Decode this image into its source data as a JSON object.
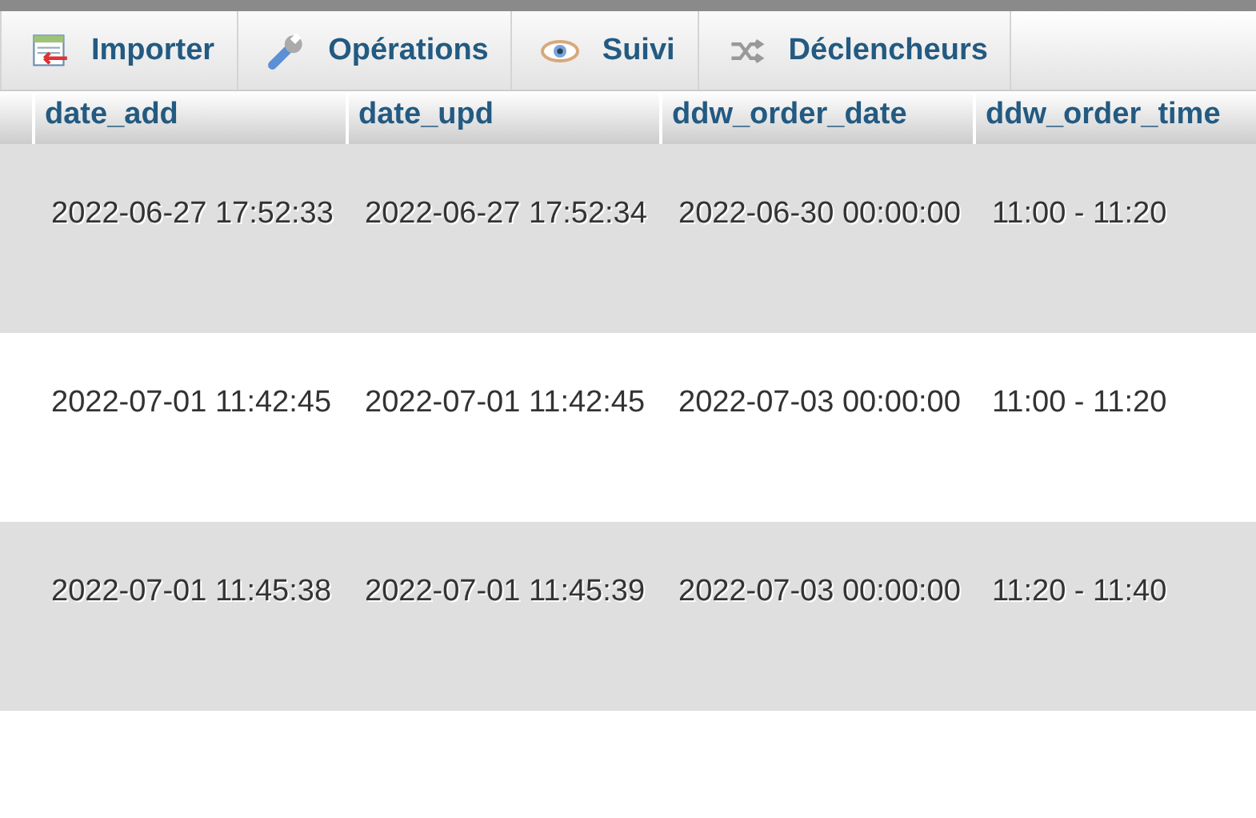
{
  "tabs": [
    {
      "label": "Importer",
      "kind": "import"
    },
    {
      "label": "Opérations",
      "kind": "wrench"
    },
    {
      "label": "Suivi",
      "kind": "eye"
    },
    {
      "label": "Déclencheurs",
      "kind": "trigger"
    }
  ],
  "table": {
    "columns": [
      "date_add",
      "date_upd",
      "ddw_order_date",
      "ddw_order_time"
    ],
    "rows": [
      {
        "cells": [
          "2022-06-27 17:52:33",
          "2022-06-27 17:52:34",
          "2022-06-30 00:00:00",
          "11:00 - 11:20"
        ]
      },
      {
        "cells": [
          "2022-07-01 11:42:45",
          "2022-07-01 11:42:45",
          "2022-07-03 00:00:00",
          "11:00 - 11:20"
        ]
      },
      {
        "cells": [
          "2022-07-01 11:45:38",
          "2022-07-01 11:45:39",
          "2022-07-03 00:00:00",
          "11:20 - 11:40"
        ]
      }
    ]
  }
}
